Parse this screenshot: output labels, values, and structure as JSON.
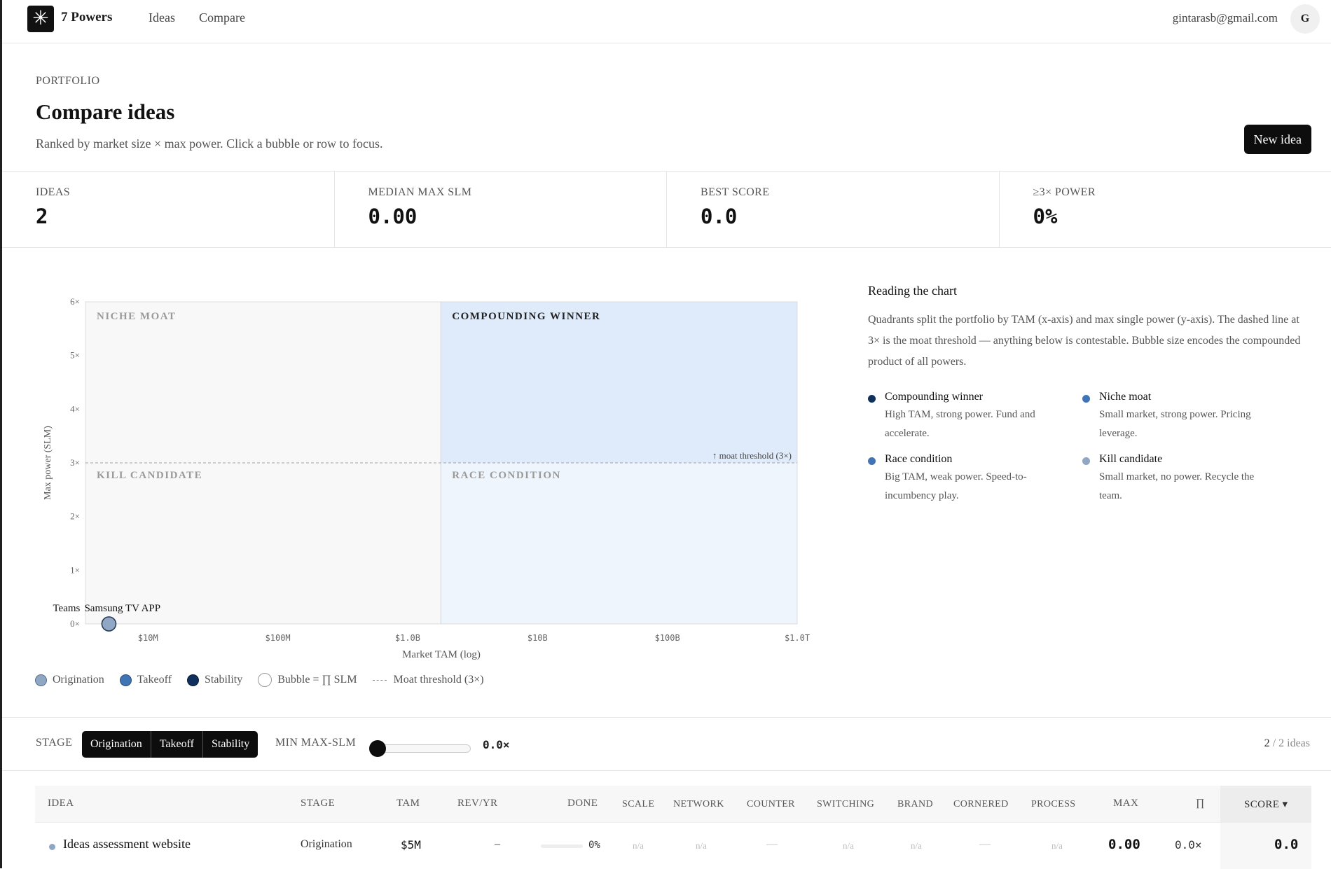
{
  "header": {
    "logo_glyph": "✳",
    "brand": "7 Powers",
    "nav": [
      {
        "label": "Ideas"
      },
      {
        "label": "Compare"
      }
    ],
    "user_email": "gintarasb@gmail.com",
    "avatar_initial": "G"
  },
  "page": {
    "eyebrow": "PORTFOLIO",
    "title": "Compare ideas",
    "subtitle": "Ranked by market size × max power. Click a bubble or row to focus.",
    "new_idea_label": "New idea"
  },
  "kpis": [
    {
      "label": "IDEAS",
      "value": "2"
    },
    {
      "label": "MEDIAN MAX SLM",
      "value": "0.00"
    },
    {
      "label": "BEST SCORE",
      "value": "0.0"
    },
    {
      "label": "≥3× POWER",
      "value": "0%"
    }
  ],
  "chart_data": {
    "type": "scatter",
    "xlabel": "Market TAM (log)",
    "ylabel": "Max power (SLM)",
    "x_scale": "log",
    "x_ticks": [
      {
        "value": 10000000,
        "label": "$10M"
      },
      {
        "value": 100000000,
        "label": "$100M"
      },
      {
        "value": 1000000000,
        "label": "$1.0B"
      },
      {
        "value": 10000000000,
        "label": "$10B"
      },
      {
        "value": 100000000000,
        "label": "$100B"
      },
      {
        "value": 1000000000000,
        "label": "$1.0T"
      }
    ],
    "y_ticks": [
      {
        "value": 0,
        "label": "0×"
      },
      {
        "value": 1,
        "label": "1×"
      },
      {
        "value": 2,
        "label": "2×"
      },
      {
        "value": 3,
        "label": "3×"
      },
      {
        "value": 4,
        "label": "4×"
      },
      {
        "value": 5,
        "label": "5×"
      },
      {
        "value": 6,
        "label": "6×"
      }
    ],
    "xlim": [
      3300000,
      1000000000000
    ],
    "ylim": [
      0,
      6
    ],
    "x_split": 1800000000,
    "threshold": 3,
    "threshold_label": "↑ moat threshold (3×)",
    "quadrants": {
      "top_left": "NICHE MOAT",
      "top_right": "COMPOUNDING WINNER",
      "bottom_left": "KILL CANDIDATE",
      "bottom_right": "RACE CONDITION"
    },
    "points": [
      {
        "label": "Teams",
        "x": 5000000,
        "y": 0,
        "stage": "Origination"
      },
      {
        "label": "Samsung TV APP",
        "x": 5000000,
        "y": 0,
        "stage": "Origination"
      }
    ],
    "grid": false
  },
  "chart_legend": [
    {
      "label": "Origination",
      "color": "#8fa7c4"
    },
    {
      "label": "Takeoff",
      "color": "#3f74b5"
    },
    {
      "label": "Stability",
      "color": "#0f2f5c"
    },
    {
      "label": "Bubble = ∏ SLM",
      "color": "#ffffff"
    },
    {
      "label": "Moat threshold (3×)",
      "color": ""
    }
  ],
  "reading": {
    "title": "Reading the chart",
    "body": "Quadrants split the portfolio by TAM (x-axis) and max single power (y-axis). The dashed line at 3× is the moat threshold — anything below is contestable. Bubble size encodes the compounded product of all powers.",
    "quadrants": [
      {
        "name": "Compounding winner",
        "desc": "High TAM, strong power. Fund and accelerate.",
        "color": "#0f2f5c"
      },
      {
        "name": "Niche moat",
        "desc": "Small market, strong power. Pricing leverage.",
        "color": "#3f74b5"
      },
      {
        "name": "Race condition",
        "desc": "Big TAM, weak power. Speed-to-incumbency play.",
        "color": "#3f74b5"
      },
      {
        "name": "Kill candidate",
        "desc": "Small market, no power. Recycle the team.",
        "color": "#8fa7c4"
      }
    ]
  },
  "filters": {
    "stage_label": "STAGE",
    "stages": [
      "Origination",
      "Takeoff",
      "Stability"
    ],
    "min_label": "MIN MAX-SLM",
    "min_value": "0.0×",
    "slider_fraction": 0,
    "count_shown": "2",
    "count_total": "/ 2 ideas"
  },
  "table": {
    "columns": [
      "IDEA",
      "STAGE",
      "TAM",
      "REV/YR",
      "DONE",
      "SCALE",
      "NETWORK",
      "COUNTER",
      "SWITCHING",
      "BRAND",
      "CORNERED",
      "PROCESS",
      "MAX",
      "∏",
      "SCORE ▾"
    ],
    "rows": [
      {
        "idea": "Ideas assessment website",
        "stage": "Origination",
        "tam": "$5M",
        "rev": "–",
        "done": "0%",
        "scale": "n/a",
        "network": "n/a",
        "counter": "—",
        "switching": "n/a",
        "brand": "n/a",
        "cornered": "—",
        "process": "n/a",
        "max": "0.00",
        "prod": "0.0×",
        "score": "0.0",
        "dot_color": "#8fa7c4"
      }
    ]
  }
}
